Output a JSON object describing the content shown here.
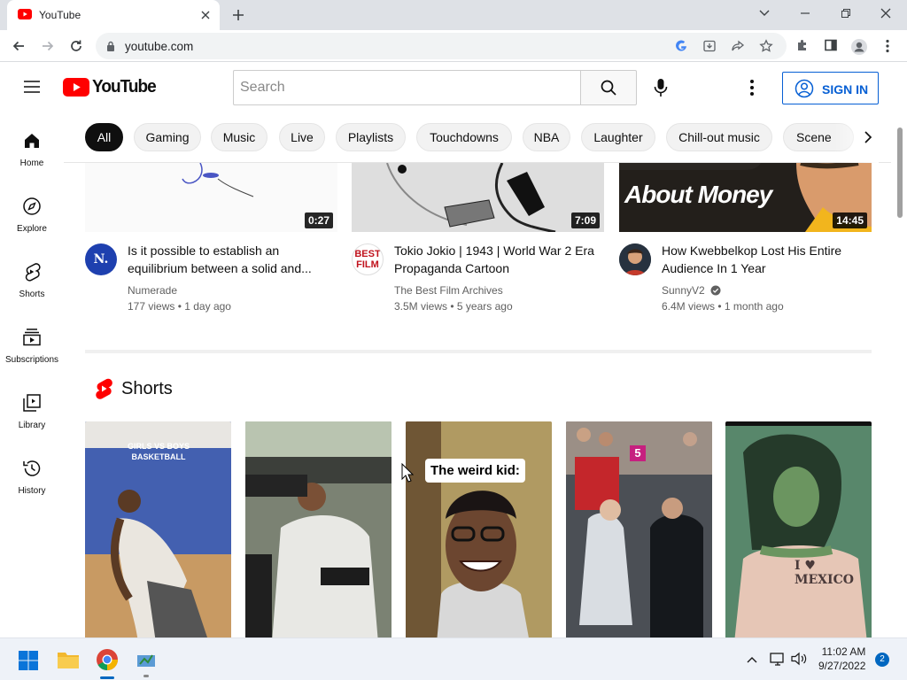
{
  "browser": {
    "tab_title": "YouTube",
    "url": "youtube.com"
  },
  "masthead": {
    "logo_text": "YouTube",
    "search_placeholder": "Search",
    "signin_label": "SIGN IN"
  },
  "chips": [
    "All",
    "Gaming",
    "Music",
    "Live",
    "Playlists",
    "Touchdowns",
    "NBA",
    "Laughter",
    "Chill-out music",
    "Scene"
  ],
  "guide": [
    "Home",
    "Explore",
    "Shorts",
    "Subscriptions",
    "Library",
    "History"
  ],
  "videos": [
    {
      "title": "Is it possible to establish an equilibrium between a solid and...",
      "channel": "Numerade",
      "views": "177 views",
      "age": "1 day ago",
      "duration": "0:27",
      "verified": false,
      "avatar_text": "N."
    },
    {
      "title": "Tokio Jokio | 1943 | World War 2 Era Propaganda Cartoon",
      "channel": "The Best Film Archives",
      "views": "3.5M views",
      "age": "5 years ago",
      "duration": "7:09",
      "verified": false,
      "avatar_text": "BEST FILM"
    },
    {
      "title": "How Kwebbelkop Lost His Entire Audience In 1 Year",
      "channel": "SunnyV2",
      "views": "6.4M views",
      "age": "1 month ago",
      "duration": "14:45",
      "verified": true,
      "thumb_text": "About Money"
    }
  ],
  "shorts": {
    "heading": "Shorts",
    "items": [
      {
        "overlay": "GIRLS VS BOYS BASKETBALL"
      },
      {
        "overlay": ""
      },
      {
        "overlay": "The weird kid:"
      },
      {
        "overlay": "5"
      },
      {
        "overlay": "I ♥ MEXICO"
      }
    ]
  },
  "system": {
    "time": "11:02 AM",
    "date": "9/27/2022",
    "notifications": "2"
  },
  "colors": {
    "yt_red": "#ff0000",
    "link_blue": "#065fd4",
    "chip_active": "#0f0f0f"
  }
}
